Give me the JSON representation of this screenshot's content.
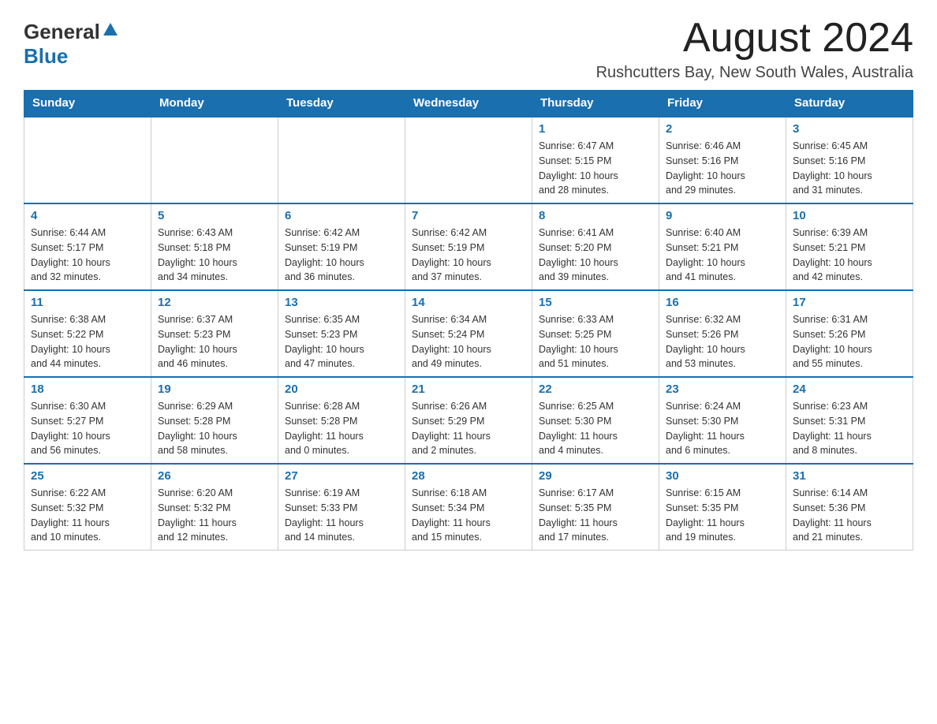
{
  "header": {
    "logo_general": "General",
    "logo_blue": "Blue",
    "month_title": "August 2024",
    "location": "Rushcutters Bay, New South Wales, Australia"
  },
  "calendar": {
    "days_of_week": [
      "Sunday",
      "Monday",
      "Tuesday",
      "Wednesday",
      "Thursday",
      "Friday",
      "Saturday"
    ],
    "weeks": [
      [
        {
          "day": "",
          "info": ""
        },
        {
          "day": "",
          "info": ""
        },
        {
          "day": "",
          "info": ""
        },
        {
          "day": "",
          "info": ""
        },
        {
          "day": "1",
          "info": "Sunrise: 6:47 AM\nSunset: 5:15 PM\nDaylight: 10 hours\nand 28 minutes."
        },
        {
          "day": "2",
          "info": "Sunrise: 6:46 AM\nSunset: 5:16 PM\nDaylight: 10 hours\nand 29 minutes."
        },
        {
          "day": "3",
          "info": "Sunrise: 6:45 AM\nSunset: 5:16 PM\nDaylight: 10 hours\nand 31 minutes."
        }
      ],
      [
        {
          "day": "4",
          "info": "Sunrise: 6:44 AM\nSunset: 5:17 PM\nDaylight: 10 hours\nand 32 minutes."
        },
        {
          "day": "5",
          "info": "Sunrise: 6:43 AM\nSunset: 5:18 PM\nDaylight: 10 hours\nand 34 minutes."
        },
        {
          "day": "6",
          "info": "Sunrise: 6:42 AM\nSunset: 5:19 PM\nDaylight: 10 hours\nand 36 minutes."
        },
        {
          "day": "7",
          "info": "Sunrise: 6:42 AM\nSunset: 5:19 PM\nDaylight: 10 hours\nand 37 minutes."
        },
        {
          "day": "8",
          "info": "Sunrise: 6:41 AM\nSunset: 5:20 PM\nDaylight: 10 hours\nand 39 minutes."
        },
        {
          "day": "9",
          "info": "Sunrise: 6:40 AM\nSunset: 5:21 PM\nDaylight: 10 hours\nand 41 minutes."
        },
        {
          "day": "10",
          "info": "Sunrise: 6:39 AM\nSunset: 5:21 PM\nDaylight: 10 hours\nand 42 minutes."
        }
      ],
      [
        {
          "day": "11",
          "info": "Sunrise: 6:38 AM\nSunset: 5:22 PM\nDaylight: 10 hours\nand 44 minutes."
        },
        {
          "day": "12",
          "info": "Sunrise: 6:37 AM\nSunset: 5:23 PM\nDaylight: 10 hours\nand 46 minutes."
        },
        {
          "day": "13",
          "info": "Sunrise: 6:35 AM\nSunset: 5:23 PM\nDaylight: 10 hours\nand 47 minutes."
        },
        {
          "day": "14",
          "info": "Sunrise: 6:34 AM\nSunset: 5:24 PM\nDaylight: 10 hours\nand 49 minutes."
        },
        {
          "day": "15",
          "info": "Sunrise: 6:33 AM\nSunset: 5:25 PM\nDaylight: 10 hours\nand 51 minutes."
        },
        {
          "day": "16",
          "info": "Sunrise: 6:32 AM\nSunset: 5:26 PM\nDaylight: 10 hours\nand 53 minutes."
        },
        {
          "day": "17",
          "info": "Sunrise: 6:31 AM\nSunset: 5:26 PM\nDaylight: 10 hours\nand 55 minutes."
        }
      ],
      [
        {
          "day": "18",
          "info": "Sunrise: 6:30 AM\nSunset: 5:27 PM\nDaylight: 10 hours\nand 56 minutes."
        },
        {
          "day": "19",
          "info": "Sunrise: 6:29 AM\nSunset: 5:28 PM\nDaylight: 10 hours\nand 58 minutes."
        },
        {
          "day": "20",
          "info": "Sunrise: 6:28 AM\nSunset: 5:28 PM\nDaylight: 11 hours\nand 0 minutes."
        },
        {
          "day": "21",
          "info": "Sunrise: 6:26 AM\nSunset: 5:29 PM\nDaylight: 11 hours\nand 2 minutes."
        },
        {
          "day": "22",
          "info": "Sunrise: 6:25 AM\nSunset: 5:30 PM\nDaylight: 11 hours\nand 4 minutes."
        },
        {
          "day": "23",
          "info": "Sunrise: 6:24 AM\nSunset: 5:30 PM\nDaylight: 11 hours\nand 6 minutes."
        },
        {
          "day": "24",
          "info": "Sunrise: 6:23 AM\nSunset: 5:31 PM\nDaylight: 11 hours\nand 8 minutes."
        }
      ],
      [
        {
          "day": "25",
          "info": "Sunrise: 6:22 AM\nSunset: 5:32 PM\nDaylight: 11 hours\nand 10 minutes."
        },
        {
          "day": "26",
          "info": "Sunrise: 6:20 AM\nSunset: 5:32 PM\nDaylight: 11 hours\nand 12 minutes."
        },
        {
          "day": "27",
          "info": "Sunrise: 6:19 AM\nSunset: 5:33 PM\nDaylight: 11 hours\nand 14 minutes."
        },
        {
          "day": "28",
          "info": "Sunrise: 6:18 AM\nSunset: 5:34 PM\nDaylight: 11 hours\nand 15 minutes."
        },
        {
          "day": "29",
          "info": "Sunrise: 6:17 AM\nSunset: 5:35 PM\nDaylight: 11 hours\nand 17 minutes."
        },
        {
          "day": "30",
          "info": "Sunrise: 6:15 AM\nSunset: 5:35 PM\nDaylight: 11 hours\nand 19 minutes."
        },
        {
          "day": "31",
          "info": "Sunrise: 6:14 AM\nSunset: 5:36 PM\nDaylight: 11 hours\nand 21 minutes."
        }
      ]
    ]
  }
}
